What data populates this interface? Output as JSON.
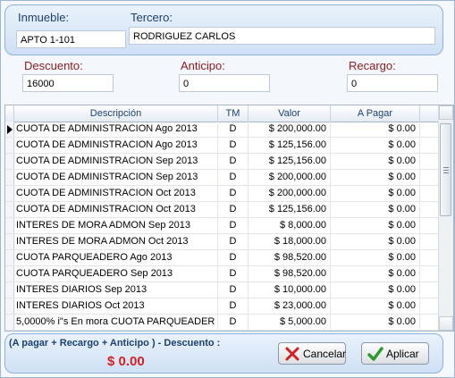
{
  "header": {
    "inmueble_label": "Inmueble:",
    "inmueble_value": "APTO 1-101",
    "tercero_label": "Tercero:",
    "tercero_value": "RODRIGUEZ  CARLOS"
  },
  "adjustments": {
    "descuento_label": "Descuento:",
    "descuento_value": "16000",
    "anticipo_label": "Anticipo:",
    "anticipo_value": "0",
    "recargo_label": "Recargo:",
    "recargo_value": "0"
  },
  "grid": {
    "columns": [
      "Descripción",
      "TM",
      "Valor",
      "A Pagar"
    ],
    "rows": [
      {
        "desc": "CUOTA DE ADMINISTRACION Ago 2013",
        "tm": "D",
        "valor": "$ 200,000.00",
        "pagar": "$ 0.00"
      },
      {
        "desc": "CUOTA DE ADMINISTRACION Ago 2013",
        "tm": "D",
        "valor": "$ 125,156.00",
        "pagar": "$ 0.00"
      },
      {
        "desc": "CUOTA DE ADMINISTRACION Sep 2013",
        "tm": "D",
        "valor": "$ 125,156.00",
        "pagar": "$ 0.00"
      },
      {
        "desc": "CUOTA DE ADMINISTRACION Sep 2013",
        "tm": "D",
        "valor": "$ 200,000.00",
        "pagar": "$ 0.00"
      },
      {
        "desc": "CUOTA DE ADMINISTRACION Oct 2013",
        "tm": "D",
        "valor": "$ 200,000.00",
        "pagar": "$ 0.00"
      },
      {
        "desc": "CUOTA DE ADMINISTRACION Oct 2013",
        "tm": "D",
        "valor": "$ 125,156.00",
        "pagar": "$ 0.00"
      },
      {
        "desc": "INTERES DE MORA ADMON Sep 2013",
        "tm": "D",
        "valor": "$ 8,000.00",
        "pagar": "$ 0.00"
      },
      {
        "desc": "INTERES DE MORA ADMON Oct 2013",
        "tm": "D",
        "valor": "$ 18,000.00",
        "pagar": "$ 0.00"
      },
      {
        "desc": "CUOTA PARQUEADERO Ago 2013",
        "tm": "D",
        "valor": "$ 98,520.00",
        "pagar": "$ 0.00"
      },
      {
        "desc": "CUOTA PARQUEADERO Sep 2013",
        "tm": "D",
        "valor": "$ 98,520.00",
        "pagar": "$ 0.00"
      },
      {
        "desc": "INTERES DIARIOS Sep 2013",
        "tm": "D",
        "valor": "$ 10,000.00",
        "pagar": "$ 0.00"
      },
      {
        "desc": "INTERES DIARIOS Oct 2013",
        "tm": "D",
        "valor": "$ 23,000.00",
        "pagar": "$ 0.00"
      },
      {
        "desc": "  5,0000% i\"s  En mora CUOTA PARQUEADER",
        "tm": "D",
        "valor": "$ 5,000.00",
        "pagar": "$ 0.00"
      }
    ]
  },
  "footer": {
    "formula": "(A pagar + Recargo + Anticipo ) - Descuento :",
    "total": "$ 0.00",
    "cancel_label": "Cancelar",
    "apply_label": "Aplicar"
  },
  "colors": {
    "label_blue": "#1d3f72",
    "label_red": "#8b1a1a",
    "total_red": "#d42020",
    "panel_border": "#8eb1da"
  }
}
